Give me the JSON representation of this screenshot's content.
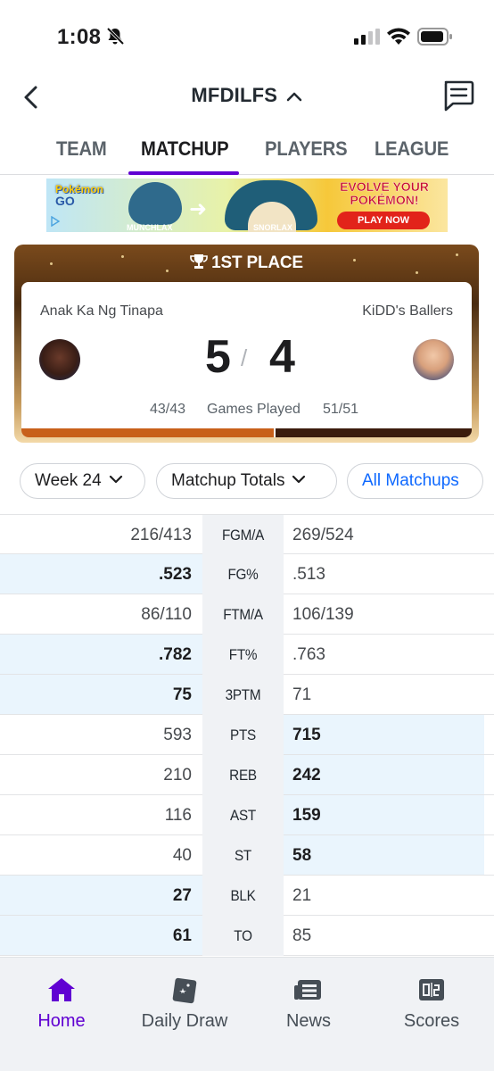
{
  "status_bar": {
    "time": "1:08"
  },
  "header": {
    "title": "MFDILFS"
  },
  "tabs": [
    {
      "label": "TEAM"
    },
    {
      "label": "MATCHUP",
      "active": true
    },
    {
      "label": "PLAYERS"
    },
    {
      "label": "LEAGUE"
    }
  ],
  "ad": {
    "logo_text": "Pokémon",
    "logo_go": "GO",
    "pokemon_left": "MUNCHLAX",
    "pokemon_right": "SNORLAX",
    "headline": "EVOLVE YOUR POKÉMON!",
    "cta": "PLAY NOW"
  },
  "matchup": {
    "place_label": "1ST PLACE",
    "team_left": {
      "name": "Anak Ka Ng Tinapa",
      "score": "5",
      "games_played": "43/43"
    },
    "team_right": {
      "name": "KiDD's Ballers",
      "score": "4",
      "games_played": "51/51"
    },
    "score_separator": "/",
    "games_played_label": "Games Played",
    "progress_left_fraction": 0.56
  },
  "filters": {
    "week": "Week 24",
    "totals": "Matchup Totals",
    "all_matchups": "All Matchups"
  },
  "stats": [
    {
      "cat": "FGM/A",
      "left": "216/413",
      "right": "269/524",
      "winner": "none"
    },
    {
      "cat": "FG%",
      "left": ".523",
      "right": ".513",
      "winner": "left"
    },
    {
      "cat": "FTM/A",
      "left": "86/110",
      "right": "106/139",
      "winner": "none"
    },
    {
      "cat": "FT%",
      "left": ".782",
      "right": ".763",
      "winner": "left"
    },
    {
      "cat": "3PTM",
      "left": "75",
      "right": "71",
      "winner": "left"
    },
    {
      "cat": "PTS",
      "left": "593",
      "right": "715",
      "winner": "right"
    },
    {
      "cat": "REB",
      "left": "210",
      "right": "242",
      "winner": "right"
    },
    {
      "cat": "AST",
      "left": "116",
      "right": "159",
      "winner": "right"
    },
    {
      "cat": "ST",
      "left": "40",
      "right": "58",
      "winner": "right"
    },
    {
      "cat": "BLK",
      "left": "27",
      "right": "21",
      "winner": "left"
    },
    {
      "cat": "TO",
      "left": "61",
      "right": "85",
      "winner": "left"
    }
  ],
  "bottom_nav": [
    {
      "label": "Home",
      "icon": "home-icon",
      "active": true
    },
    {
      "label": "Daily Draw",
      "icon": "daily-draw-icon"
    },
    {
      "label": "News",
      "icon": "news-icon"
    },
    {
      "label": "Scores",
      "icon": "scores-icon"
    }
  ],
  "colors": {
    "accent": "#6001d2",
    "link": "#0f69ff",
    "highlight": "#eaf5fd"
  }
}
